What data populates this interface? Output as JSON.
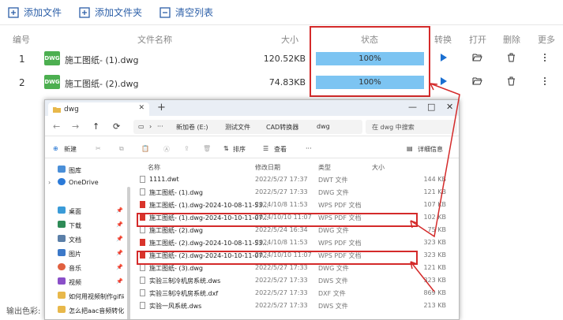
{
  "toolbar": {
    "add_file": "添加文件",
    "add_folder": "添加文件夹",
    "clear_list": "清空列表"
  },
  "columns": {
    "num": "编号",
    "name": "文件名称",
    "size": "大小",
    "status": "状态",
    "convert": "转换",
    "open": "打开",
    "delete": "删除",
    "more": "更多"
  },
  "files": [
    {
      "num": "1",
      "icon": "DWG",
      "name": "施工图纸- (1).dwg",
      "size": "120.52KB",
      "progress": 100,
      "progress_label": "100%"
    },
    {
      "num": "2",
      "icon": "DWG",
      "name": "施工图纸- (2).dwg",
      "size": "74.83KB",
      "progress": 100,
      "progress_label": "100%"
    }
  ],
  "bottom_label": "输出色彩:",
  "explorer": {
    "tab_title": "dwg",
    "address": {
      "computer": "›",
      "ellipsis": "···",
      "drive": "新加卷 (E:)",
      "folder1": "测试文件",
      "folder2": "CAD转换器",
      "folder3": "dwg"
    },
    "search_placeholder": "在 dwg 中搜索",
    "commands": {
      "new": "新建",
      "sort": "排序",
      "view": "查看",
      "more": "···",
      "details": "详细信息"
    },
    "sidebar": [
      {
        "label": "图库",
        "pin": ""
      },
      {
        "label": "OneDrive",
        "pin": ""
      },
      {
        "label": "桌面",
        "pin": "📌"
      },
      {
        "label": "下载",
        "pin": "📌"
      },
      {
        "label": "文档",
        "pin": "📌"
      },
      {
        "label": "图片",
        "pin": "📌"
      },
      {
        "label": "音乐",
        "pin": "📌"
      },
      {
        "label": "视频",
        "pin": "📌"
      },
      {
        "label": "如何用视频制作gif动态图",
        "pin": ""
      },
      {
        "label": "怎么把aac音频转化为mp",
        "pin": ""
      }
    ],
    "list_headers": {
      "name": "名称",
      "date": "修改日期",
      "type": "类型",
      "size": "大小"
    },
    "files": [
      {
        "name": "1111.dwt",
        "date": "2022/5/27 17:37",
        "type": "DWT 文件",
        "size": "144 KB",
        "pdf": false
      },
      {
        "name": "施工图纸- (1).dwg",
        "date": "2022/5/27 17:33",
        "type": "DWG 文件",
        "size": "121 KB",
        "pdf": false
      },
      {
        "name": "施工图纸- (1).dwg-2024-10-08-11-53...",
        "date": "2024/10/8 11:53",
        "type": "WPS PDF 文档",
        "size": "107 KB",
        "pdf": true
      },
      {
        "name": "施工图纸- (1).dwg-2024-10-10-11-07...",
        "date": "2024/10/10 11:07",
        "type": "WPS PDF 文档",
        "size": "102 KB",
        "pdf": true
      },
      {
        "name": "施工图纸- (2).dwg",
        "date": "2022/5/24 16:34",
        "type": "DWG 文件",
        "size": "75 KB",
        "pdf": false
      },
      {
        "name": "施工图纸- (2).dwg-2024-10-08-11-53...",
        "date": "2024/10/8 11:53",
        "type": "WPS PDF 文档",
        "size": "323 KB",
        "pdf": true
      },
      {
        "name": "施工图纸- (2).dwg-2024-10-10-11-07...",
        "date": "2024/10/10 11:07",
        "type": "WPS PDF 文档",
        "size": "323 KB",
        "pdf": true
      },
      {
        "name": "施工图纸- (3).dwg",
        "date": "2022/5/27 17:33",
        "type": "DWG 文件",
        "size": "121 KB",
        "pdf": false
      },
      {
        "name": "实验三制冷机房系统.dws",
        "date": "2022/5/27 17:33",
        "type": "DWS 文件",
        "size": "323 KB",
        "pdf": false
      },
      {
        "name": "实验三制冷机房系统.dxf",
        "date": "2022/5/27 17:33",
        "type": "DXF 文件",
        "size": "869 KB",
        "pdf": false
      },
      {
        "name": "实验一风系统.dws",
        "date": "2022/5/27 17:33",
        "type": "DWS 文件",
        "size": "213 KB",
        "pdf": false
      }
    ]
  }
}
